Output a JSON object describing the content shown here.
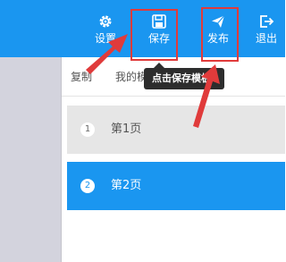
{
  "colors": {
    "accent": "#1a96f0",
    "annotation_red": "#e03b3b",
    "tooltip_bg": "#2d2d2d",
    "left_rail": "#d3d3dd"
  },
  "topbar": {
    "settings_label": "设置",
    "settings_icon": "gear-icon",
    "save_label": "保存",
    "save_icon": "save-icon",
    "publish_label": "发布",
    "publish_icon": "send-icon",
    "exit_label": "退出",
    "exit_icon": "logout-icon"
  },
  "toolbar": {
    "copy_label": "复制",
    "mine_label": "我的模板"
  },
  "tooltip": {
    "text": "点击保存模板"
  },
  "pages": [
    {
      "number": "1",
      "label": "第1页",
      "selected": false
    },
    {
      "number": "2",
      "label": "第2页",
      "selected": true
    }
  ]
}
